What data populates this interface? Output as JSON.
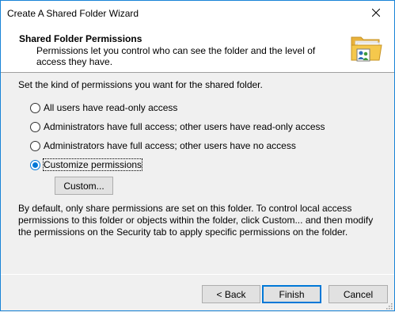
{
  "window": {
    "title": "Create A Shared Folder Wizard"
  },
  "header": {
    "title": "Shared Folder Permissions",
    "description": "Permissions let you control who can see the folder and the level of access they have."
  },
  "prompt": "Set the kind of permissions you want for the shared folder.",
  "options": [
    {
      "label": "All users have read-only access",
      "selected": false
    },
    {
      "label": "Administrators have full access; other users have read-only access",
      "selected": false
    },
    {
      "label": "Administrators have full access; other users have no access",
      "selected": false
    },
    {
      "label": "Customize permissions",
      "selected": true
    }
  ],
  "custom_button": "Custom...",
  "info_text": "By default, only share permissions are set on this folder. To control local access permissions to this folder or objects within the folder, click Custom... and then modify the permissions on the Security tab to apply specific permissions on the folder.",
  "footer": {
    "back": "< Back",
    "finish": "Finish",
    "cancel": "Cancel"
  },
  "colors": {
    "accent": "#0078d7",
    "window_border": "#1883d7",
    "folder": "#f5c84c"
  }
}
